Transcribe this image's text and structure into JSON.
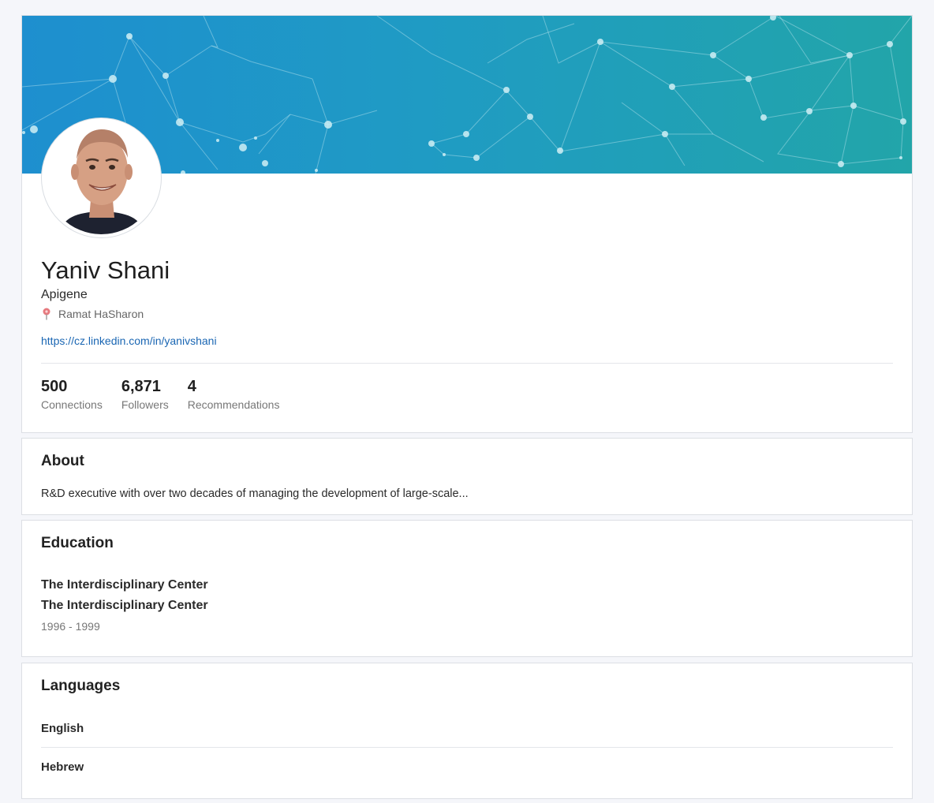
{
  "profile": {
    "name": "Yaniv Shani",
    "company": "Apigene",
    "location": "Ramat HaSharon",
    "url": "https://cz.linkedin.com/in/yanivshani",
    "stats": [
      {
        "value": "500",
        "label": "Connections"
      },
      {
        "value": "6,871",
        "label": "Followers"
      },
      {
        "value": "4",
        "label": "Recommendations"
      }
    ]
  },
  "about": {
    "title": "About",
    "text": "R&D executive with over two decades of managing the development of large-scale..."
  },
  "education": {
    "title": "Education",
    "entries": [
      {
        "school": "The Interdisciplinary Center",
        "degree": "The Interdisciplinary Center",
        "years": "1996 - 1999"
      }
    ]
  },
  "languages": {
    "title": "Languages",
    "items": [
      "English",
      "Hebrew"
    ]
  },
  "icons": {
    "location": "map-pin-icon"
  },
  "colors": {
    "link": "#1a66b3",
    "banner_start": "#1e8fcf",
    "banner_end": "#22a5a9"
  }
}
